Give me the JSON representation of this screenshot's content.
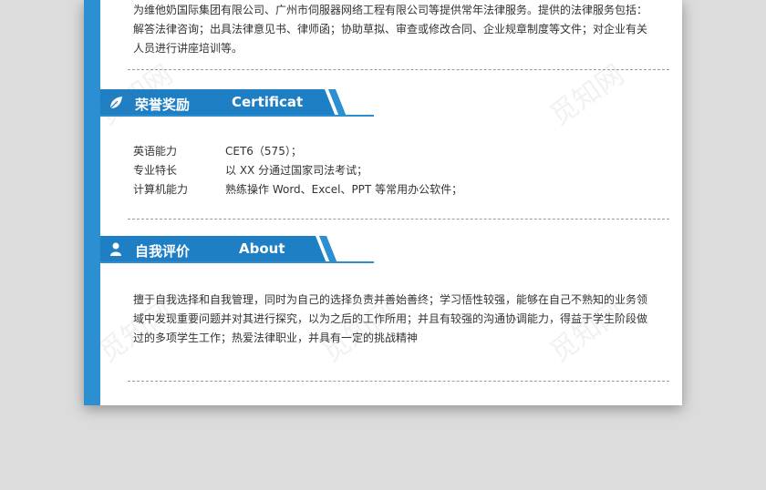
{
  "experience": {
    "lines": [
      "为维他奶国际集团有限公司、广州市伺服器网络工程有限公司等提供常年法律服务。提供的法律服务包括：",
      "解答法律咨询；出具法律意见书、律师函；协助草拟、审查或修改合同、企业规章制度等文件；对企业有关",
      "人员进行讲座培训等。"
    ]
  },
  "honors": {
    "title_cn": "荣誉奖励",
    "title_en": "Certificat",
    "icon": "leaf-icon",
    "rows": [
      {
        "label": "英语能力",
        "value": "CET6（575）；"
      },
      {
        "label": "专业特长",
        "value": "以 XX 分通过国家司法考试；"
      },
      {
        "label": "计算机能力",
        "value": "熟练操作 Word、Excel、PPT 等常用办公软件；"
      }
    ]
  },
  "self_eval": {
    "title_cn": "自我评价",
    "title_en": "About",
    "icon": "person-icon",
    "lines": [
      "擅于自我选择和自我管理，同时为自己的选择负责并善始善终；学习悟性较强，能够在自己不熟知的业务领",
      "域中发现重要问题并对其进行探究，以为之后的工作所用；并且有较强的沟通协调能力，得益于学生阶段做",
      "过的多项学生工作；热爱法律职业，并具有一定的挑战精神"
    ]
  },
  "watermark": "觅知网",
  "colors": {
    "accent_blue": "#2c8fd1",
    "header_blue": "#1f7fc4",
    "text": "#333333",
    "background": "#dcdcdc"
  }
}
